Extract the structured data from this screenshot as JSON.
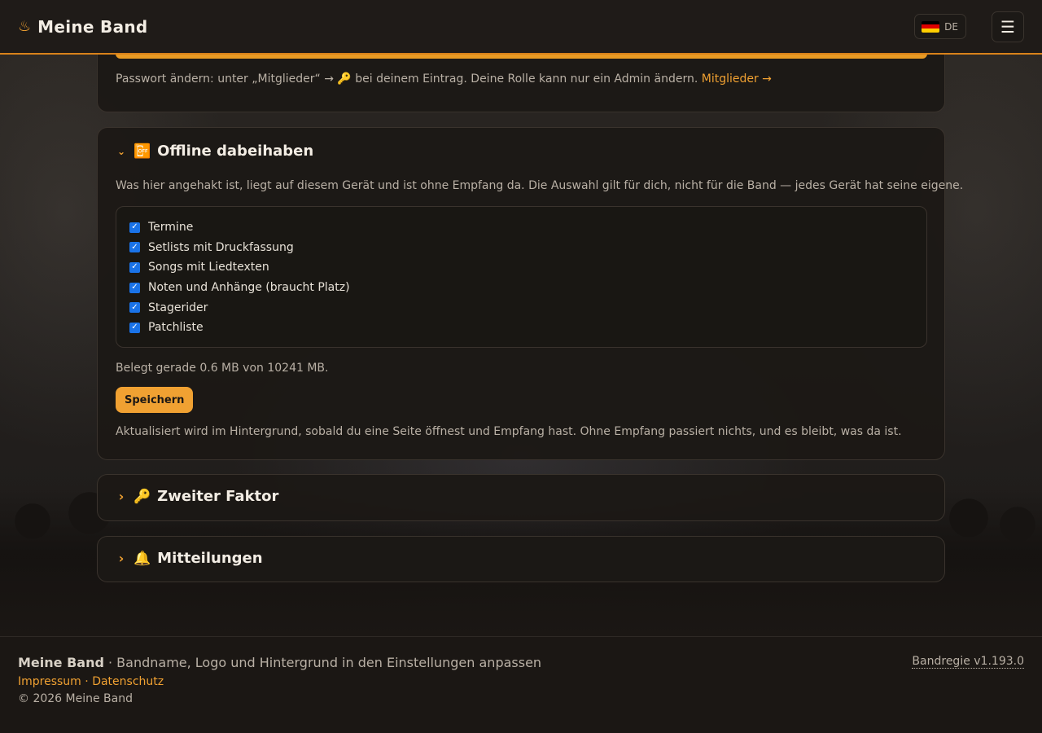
{
  "header": {
    "brand_icon": "♨",
    "brand_name": "Meine Band",
    "lang_code": "DE",
    "menu_icon": "☰"
  },
  "top_card": {
    "note_text": "Passwort ändern: unter „Mitglieder“ → 🔑 bei deinem Eintrag. Deine Rolle kann nur ein Admin ändern.",
    "note_link": "Mitglieder →"
  },
  "offline": {
    "chevron": "⌄",
    "icon": "📴",
    "title": "Offline dabeihaben",
    "description": "Was hier angehakt ist, liegt auf diesem Gerät und ist ohne Empfang da. Die Auswahl gilt für dich, nicht für die Band — jedes Gerät hat seine eigene.",
    "items": [
      {
        "label": "Termine",
        "checked": true
      },
      {
        "label": "Setlists mit Druckfassung",
        "checked": true
      },
      {
        "label": "Songs mit Liedtexten",
        "checked": true
      },
      {
        "label": "Noten und Anhänge (braucht Platz)",
        "checked": true
      },
      {
        "label": "Stagerider",
        "checked": true
      },
      {
        "label": "Patchliste",
        "checked": true
      }
    ],
    "usage": "Belegt gerade 0.6 MB von 10241 MB.",
    "save_label": "Speichern",
    "footnote": "Aktualisiert wird im Hintergrund, sobald du eine Seite öffnest und Empfang hast. Ohne Empfang passiert nichts, und es bleibt, was da ist."
  },
  "two_factor": {
    "chevron": "›",
    "icon": "🔑",
    "title": "Zweiter Faktor"
  },
  "notifications": {
    "chevron": "›",
    "icon": "🔔",
    "title": "Mitteilungen"
  },
  "footer": {
    "brand": "Meine Band",
    "tagline": " · Bandname, Logo und Hintergrund in den Einstellungen anpassen",
    "link_impressum": "Impressum",
    "link_sep": " · ",
    "link_datenschutz": "Datenschutz",
    "copyright": "© 2026 Meine Band",
    "version": "Bandregie v1.193.0"
  },
  "colors": {
    "accent": "#f0a132",
    "accent_border": "#d9821a",
    "checkbox": "#1a73e8"
  }
}
